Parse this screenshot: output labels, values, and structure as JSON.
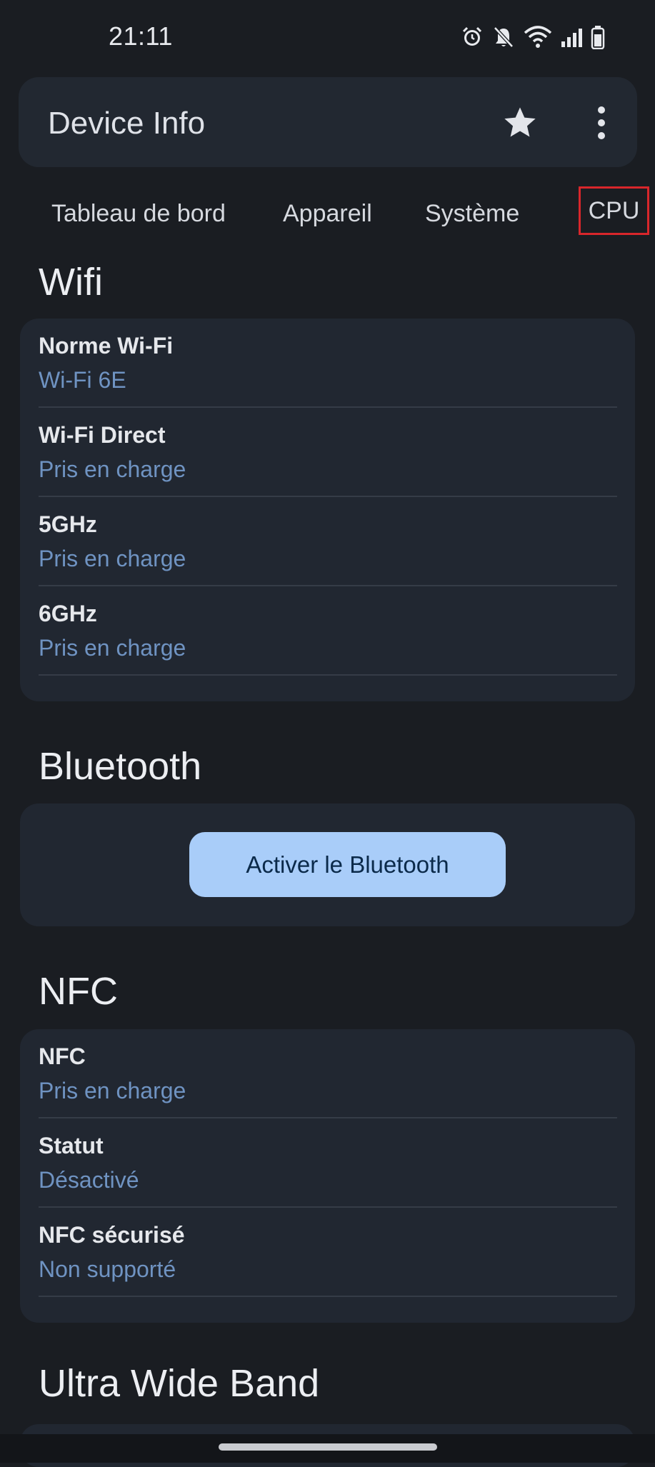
{
  "status_bar": {
    "time": "21:11",
    "icons": [
      "alarm-icon",
      "silent-bell-icon",
      "wifi-icon",
      "signal-icon",
      "battery-icon"
    ]
  },
  "app_bar": {
    "title": "Device Info",
    "actions": [
      "star-icon",
      "more-vert-icon"
    ]
  },
  "tabs": [
    {
      "label": "Tableau de bord"
    },
    {
      "label": "Appareil"
    },
    {
      "label": "Système"
    },
    {
      "label": "CPU",
      "highlighted": true
    }
  ],
  "sections": {
    "wifi": {
      "title": "Wifi",
      "rows": [
        {
          "label": "Norme Wi-Fi",
          "value": "Wi-Fi 6E"
        },
        {
          "label": "Wi-Fi Direct",
          "value": "Pris en charge"
        },
        {
          "label": "5GHz",
          "value": "Pris en charge"
        },
        {
          "label": "6GHz",
          "value": "Pris en charge"
        }
      ]
    },
    "bluetooth": {
      "title": "Bluetooth",
      "button_label": "Activer le Bluetooth"
    },
    "nfc": {
      "title": "NFC",
      "rows": [
        {
          "label": "NFC",
          "value": "Pris en charge"
        },
        {
          "label": "Statut",
          "value": "Désactivé"
        },
        {
          "label": "NFC sécurisé",
          "value": "Non supporté"
        }
      ]
    },
    "uwb": {
      "title": "Ultra Wide Band"
    }
  },
  "colors": {
    "background": "#1a1d22",
    "card": "#212731",
    "value_text": "#6f93c2",
    "button": "#a9cdf9",
    "highlight_box": "#d8262b"
  }
}
